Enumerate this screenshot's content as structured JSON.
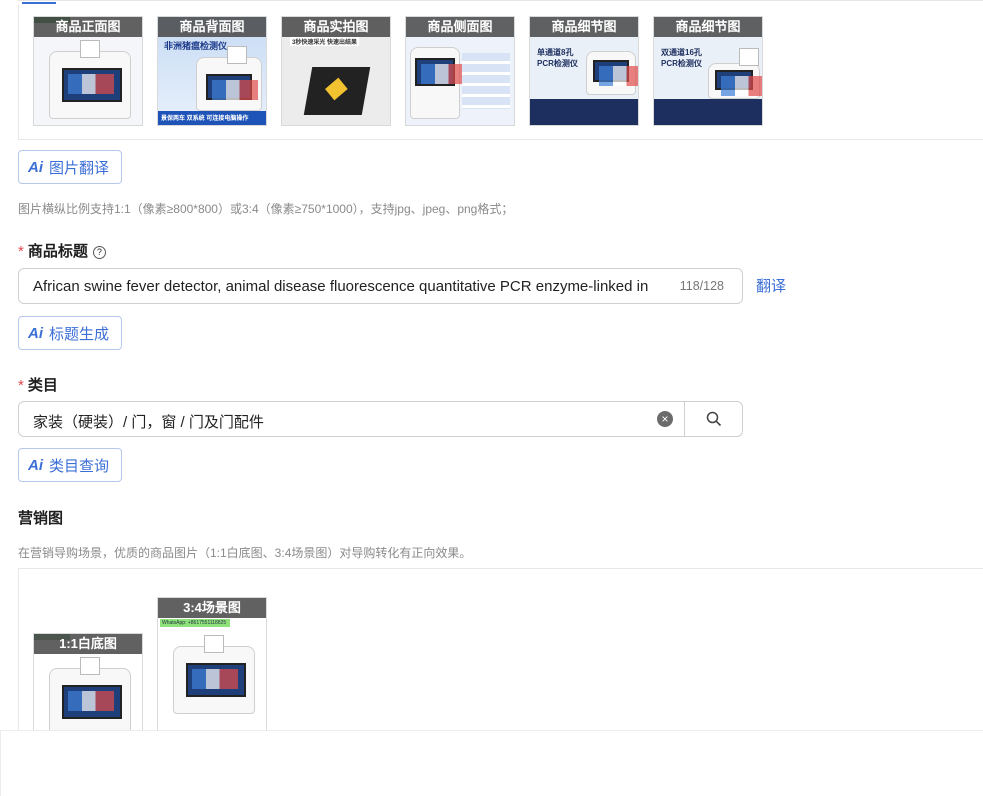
{
  "product_images": {
    "thumbs": [
      {
        "label": "商品正面图"
      },
      {
        "label": "商品背面图",
        "headline": "非洲猪瘟检测仪",
        "footer": "景保两车  双系统  可连接电脑操作"
      },
      {
        "label": "商品实拍图",
        "headline": "3秒快速采光  快速出结果"
      },
      {
        "label": "商品侧面图"
      },
      {
        "label": "商品细节图",
        "headline": "单通道8孔 PCR检测仪"
      },
      {
        "label": "商品细节图",
        "headline": "双通道16孔 PCR检测仪"
      }
    ],
    "translate_button": "图片翻译",
    "hint": "图片横纵比例支持1:1（像素≥800*800）或3:4（像素≥750*1000），支持jpg、jpeg、png格式；"
  },
  "title_field": {
    "required_mark": "*",
    "label": "商品标题",
    "help_icon": "?",
    "value": "African swine fever detector, animal disease fluorescence quantitative PCR enzyme-linked in",
    "counter": "118/128",
    "translate_link": "翻译",
    "generate_button": "标题生成"
  },
  "category_field": {
    "required_mark": "*",
    "label": "类目",
    "value": "家装（硬装）/ 门，窗 / 门及门配件",
    "clear_icon": "×",
    "query_button": "类目查询"
  },
  "marketing": {
    "label": "营销图",
    "hint": "在营销导购场景，优质的商品图片（1:1白底图、3:4场景图）对导购转化有正向效果。",
    "thumbs": [
      {
        "label": "1:1白底图"
      },
      {
        "label": "3:4场景图",
        "whatsapp": "WhatsApp: +8617551118825"
      }
    ]
  },
  "ai_icon_text": "Ai",
  "colors": {
    "accent": "#3b6fd6",
    "required": "#e5484d",
    "hint": "#8a8a8a"
  }
}
